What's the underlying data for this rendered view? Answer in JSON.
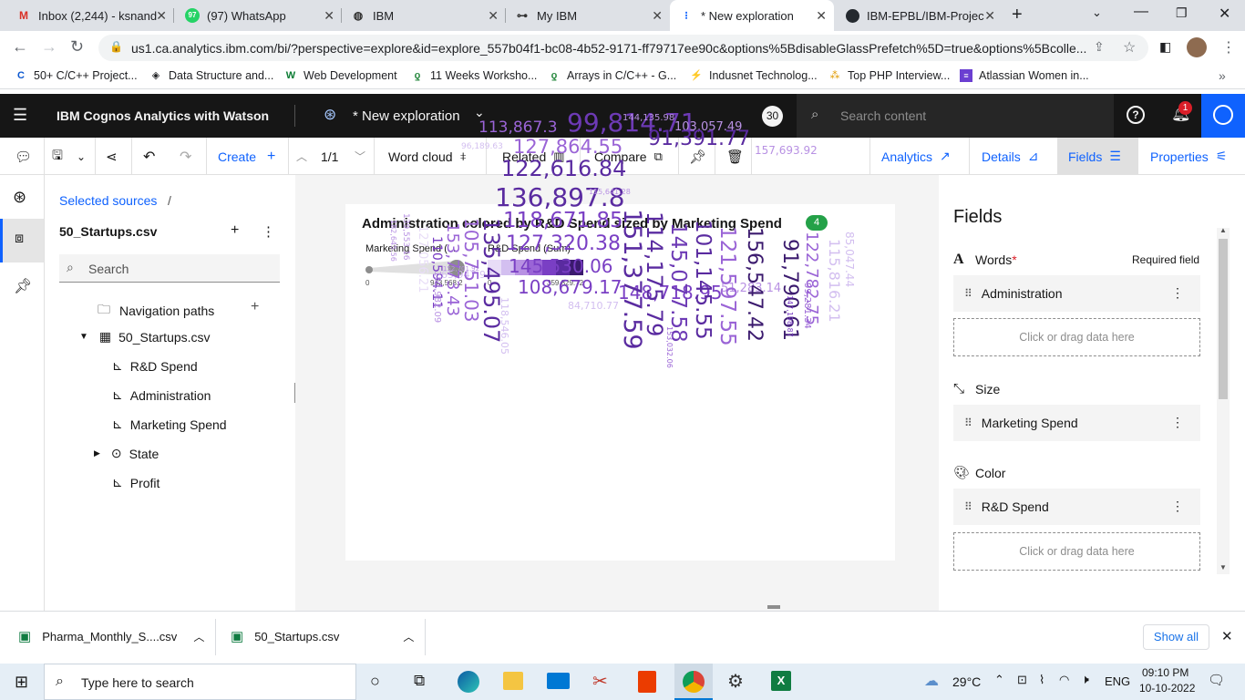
{
  "browser": {
    "tabs": [
      {
        "label": "Inbox (2,244) - ksnand",
        "icon": "gmail-icon"
      },
      {
        "label": "(97) WhatsApp",
        "icon": "whatsapp-icon",
        "badge": "97"
      },
      {
        "label": "IBM",
        "icon": "globe-icon"
      },
      {
        "label": "My IBM",
        "icon": "ibm-icon"
      },
      {
        "label": "* New exploration",
        "icon": "cognos-icon"
      },
      {
        "label": "IBM-EPBL/IBM-Projec",
        "icon": "github-icon"
      }
    ],
    "url": "us1.ca.analytics.ibm.com/bi/?perspective=explore&id=explore_557b04f1-bc08-4b52-9171-ff79717ee90c&options%5BdisableGlassPrefetch%5D=true&options%5Bcolle...",
    "bookmarks": [
      "50+ C/C++ Project...",
      "Data Structure and...",
      "Web Development",
      "11 Weeks Worksho...",
      "Arrays in C/C++ - G...",
      "Indusnet Technolog...",
      "Top PHP Interview...",
      "Atlassian Women in..."
    ]
  },
  "app": {
    "title": "IBM Cognos Analytics with Watson",
    "view_name": "* New exploration",
    "avatar_count": "30",
    "search_placeholder": "Search content",
    "notification_count": "1"
  },
  "toolbar": {
    "create": "Create",
    "page": "1/1",
    "word_cloud": "Word cloud",
    "related": "Related",
    "compare": "Compare",
    "analytics": "Analytics",
    "details": "Details",
    "fields": "Fields",
    "properties": "Properties"
  },
  "sources": {
    "breadcrumb": "Selected sources",
    "breadcrumb_sep": "/",
    "file": "50_Startups.csv",
    "search_placeholder": "Search",
    "nav_paths": "Navigation paths",
    "table": "50_Startups.csv",
    "columns": [
      "R&D Spend",
      "Administration",
      "Marketing Spend",
      "State",
      "Profit"
    ]
  },
  "chart": {
    "title": "Administration colored by R&D Spend sized by Marketing Spend",
    "badge": "4",
    "legend_size_label": "Marketing Spend (...",
    "legend_size_min": "0",
    "legend_size_max": "943,568.2",
    "legend_color_label": "R&D Spend (Sum)",
    "legend_color_min": "0",
    "legend_color_max": "359,829.72",
    "colors": [
      "#e8ddf7",
      "#d3bff0",
      "#b891e3",
      "#9a64d6",
      "#7a3fc4",
      "#5a2ba0",
      "#3b1a6e"
    ]
  },
  "chart_data": {
    "type": "wordcloud",
    "words": [
      {
        "text": "99,814.71",
        "color": "#6d3ab5",
        "rot": 0
      },
      {
        "text": "113,867.3",
        "color": "#9a64d6",
        "rot": 0
      },
      {
        "text": "103,057.49",
        "color": "#b891e3",
        "rot": 0
      },
      {
        "text": "144,135.98",
        "color": "#b891e3",
        "rot": 0
      },
      {
        "text": "127,864.55",
        "color": "#9a64d6",
        "rot": 0
      },
      {
        "text": "91,391.77",
        "color": "#5a2ba0",
        "rot": 0
      },
      {
        "text": "157,693.92",
        "color": "#b891e3",
        "rot": 0
      },
      {
        "text": "96,189.63",
        "color": "#d3bff0",
        "rot": 0
      },
      {
        "text": "122,616.84",
        "color": "#5a2ba0",
        "rot": 0
      },
      {
        "text": "136,897.8",
        "color": "#5a2ba0",
        "rot": 0
      },
      {
        "text": "118,671.85",
        "color": "#7a3fc4",
        "rot": 0
      },
      {
        "text": "127,320.38",
        "color": "#7a3fc4",
        "rot": 0
      },
      {
        "text": "145,530.06",
        "color": "#7a3fc4",
        "rot": 0
      },
      {
        "text": "108,679.17",
        "color": "#7a3fc4",
        "rot": 0
      },
      {
        "text": "148,718.95",
        "color": "#7a3fc4",
        "rot": 0
      },
      {
        "text": "115,641.28",
        "color": "#b891e3",
        "rot": 0
      },
      {
        "text": "84,710.77",
        "color": "#d3bff0",
        "rot": 0
      },
      {
        "text": "51,283.14",
        "color": "#b891e3",
        "rot": 0
      },
      {
        "text": "65,947.93",
        "color": "#d3bff0",
        "rot": 0
      },
      {
        "text": "152,701.92",
        "color": "#b891e3",
        "rot": 0
      },
      {
        "text": "135,495.07",
        "color": "#5a2ba0",
        "rot": 90
      },
      {
        "text": "105,751.03",
        "color": "#9a64d6",
        "rot": 90
      },
      {
        "text": "153,773.43",
        "color": "#9a64d6",
        "rot": 90
      },
      {
        "text": "110,594.11",
        "color": "#7a3fc4",
        "rot": 90
      },
      {
        "text": "182,645.56",
        "color": "#b891e3",
        "rot": 90
      },
      {
        "text": "139,553.16",
        "color": "#b891e3",
        "rot": 90
      },
      {
        "text": "127,056.21",
        "color": "#e8ddf7",
        "rot": 90
      },
      {
        "text": "152,982.09",
        "color": "#b891e3",
        "rot": 90
      },
      {
        "text": "151,377.59",
        "color": "#5a2ba0",
        "rot": 90
      },
      {
        "text": "114,175.79",
        "color": "#5a2ba0",
        "rot": 90
      },
      {
        "text": "145,077.58",
        "color": "#6d3ab5",
        "rot": 90
      },
      {
        "text": "101,145.55",
        "color": "#5a2ba0",
        "rot": 90
      },
      {
        "text": "121,597.55",
        "color": "#9a64d6",
        "rot": 90
      },
      {
        "text": "156,547.42",
        "color": "#3b1a6e",
        "rot": 90
      },
      {
        "text": "91,790.61",
        "color": "#3b1a6e",
        "rot": 90
      },
      {
        "text": "122,782.75",
        "color": "#9a64d6",
        "rot": 90
      },
      {
        "text": "115,816.21",
        "color": "#d3bff0",
        "rot": 90
      },
      {
        "text": "85,047.44",
        "color": "#d3bff0",
        "rot": 90
      },
      {
        "text": "99,281.34",
        "color": "#9a64d6",
        "rot": 90
      },
      {
        "text": "147,198.87",
        "color": "#7a3fc4",
        "rot": 90
      },
      {
        "text": "153,032.06",
        "color": "#9a64d6",
        "rot": 90
      },
      {
        "text": "118,546.05",
        "color": "#d3bff0",
        "rot": 90
      }
    ]
  },
  "fields": {
    "title": "Fields",
    "words_label": "Words",
    "required_mark": "*",
    "required_field": "Required field",
    "words_value": "Administration",
    "drop_placeholder": "Click or drag data here",
    "size_label": "Size",
    "size_value": "Marketing Spend",
    "color_label": "Color",
    "color_value": "R&D Spend"
  },
  "downloads": {
    "items": [
      "Pharma_Monthly_S....csv",
      "50_Startups.csv"
    ],
    "show_all": "Show all"
  },
  "taskbar": {
    "search_placeholder": "Type here to search",
    "weather": "29°C",
    "lang": "ENG",
    "time": "09:10 PM",
    "date": "10-10-2022"
  }
}
